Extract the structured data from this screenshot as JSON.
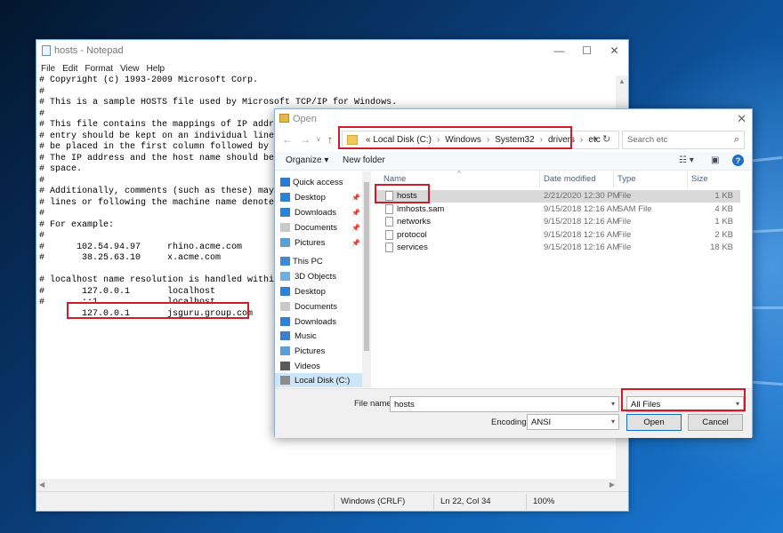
{
  "notepad": {
    "title": "hosts - Notepad",
    "menu": [
      "File",
      "Edit",
      "Format",
      "View",
      "Help"
    ],
    "lines": [
      "# Copyright (c) 1993-2009 Microsoft Corp.",
      "#",
      "# This is a sample HOSTS file used by Microsoft TCP/IP for Windows.",
      "#",
      "# This file contains the mappings of IP addresse",
      "# entry should be kept on an individual line. Th",
      "# be placed in the first column followed by the",
      "# The IP address and the host name should be sep",
      "# space.",
      "#",
      "# Additionally, comments (such as these) may be",
      "# lines or following the machine name denoted by",
      "#",
      "# For example:",
      "#",
      "#      102.54.94.97     rhino.acme.com",
      "#       38.25.63.10     x.acme.com",
      "",
      "# localhost name resolution is handled within DN",
      "#       127.0.0.1       localhost",
      "#       ::1             localhost",
      "        127.0.0.1       jsguru.group.com"
    ],
    "status": {
      "encoding": "Windows (CRLF)",
      "position": "Ln 22, Col 34",
      "zoom": "100%"
    }
  },
  "dialog": {
    "title": "Open",
    "address": {
      "prefix": "«",
      "segments": [
        "Local Disk (C:)",
        "Windows",
        "System32",
        "drivers",
        "etc"
      ]
    },
    "search_placeholder": "Search etc",
    "toolbar": {
      "organize": "Organize ▾",
      "new_folder": "New folder"
    },
    "nav": [
      {
        "label": "Quick access",
        "icon": "star-icon",
        "pinned": false
      },
      {
        "label": "Desktop",
        "icon": "desktop-icon",
        "pinned": true
      },
      {
        "label": "Downloads",
        "icon": "download-icon",
        "pinned": true
      },
      {
        "label": "Documents",
        "icon": "documents-icon",
        "pinned": true
      },
      {
        "label": "Pictures",
        "icon": "pictures-icon",
        "pinned": true
      },
      {
        "label": "This PC",
        "icon": "pc-icon",
        "pinned": false
      },
      {
        "label": "3D Objects",
        "icon": "3d-objects-icon",
        "pinned": false
      },
      {
        "label": "Desktop",
        "icon": "desktop-icon",
        "pinned": false
      },
      {
        "label": "Documents",
        "icon": "documents-icon",
        "pinned": false
      },
      {
        "label": "Downloads",
        "icon": "download-icon",
        "pinned": false
      },
      {
        "label": "Music",
        "icon": "music-icon",
        "pinned": false
      },
      {
        "label": "Pictures",
        "icon": "pictures-icon",
        "pinned": false
      },
      {
        "label": "Videos",
        "icon": "videos-icon",
        "pinned": false
      },
      {
        "label": "Local Disk (C:)",
        "icon": "drive-icon",
        "pinned": false
      }
    ],
    "columns": [
      "Name",
      "Date modified",
      "Type",
      "Size"
    ],
    "files": [
      {
        "name": "hosts",
        "date": "2/21/2020 12:30 PM",
        "type": "File",
        "size": "1 KB"
      },
      {
        "name": "lmhosts.sam",
        "date": "9/15/2018 12:16 AM",
        "type": "SAM File",
        "size": "4 KB"
      },
      {
        "name": "networks",
        "date": "9/15/2018 12:16 AM",
        "type": "File",
        "size": "1 KB"
      },
      {
        "name": "protocol",
        "date": "9/15/2018 12:16 AM",
        "type": "File",
        "size": "2 KB"
      },
      {
        "name": "services",
        "date": "9/15/2018 12:16 AM",
        "type": "File",
        "size": "18 KB"
      }
    ],
    "file_name_label": "File name:",
    "file_name_value": "hosts",
    "file_type_value": "All Files",
    "encoding_label": "Encoding:",
    "encoding_value": "ANSI",
    "open_button": "Open",
    "cancel_button": "Cancel"
  },
  "colors": {
    "highlight": "#d11a2a",
    "accent": "#1f6fc7"
  }
}
